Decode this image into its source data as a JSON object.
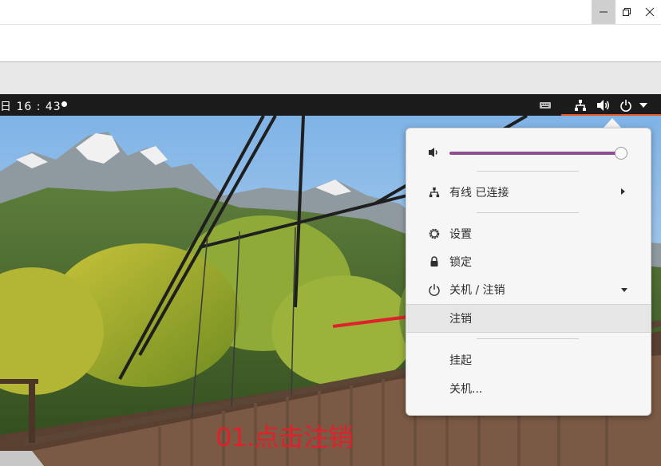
{
  "window": {
    "controls": [
      "minimize",
      "maximize",
      "close"
    ]
  },
  "topbar": {
    "clock": "日  16 : 43"
  },
  "menu": {
    "volume_level": 0.98,
    "items": [
      {
        "icon": "network-wired-icon",
        "label": "有线 已连接",
        "submenu": true
      },
      {
        "icon": "settings-icon",
        "label": "设置"
      },
      {
        "icon": "lock-icon",
        "label": "锁定"
      },
      {
        "icon": "power-icon",
        "label": "关机 / 注销",
        "expanded": true
      },
      {
        "label": "注销",
        "highlighted": true
      },
      {
        "label": "挂起"
      },
      {
        "label": "关机..."
      }
    ]
  },
  "annotation": {
    "text": "01.点击注销",
    "color": "#e0202a"
  },
  "colors": {
    "accent": "#e95420",
    "slider": "#8b4f8f",
    "topbar": "#1b1b1b"
  }
}
